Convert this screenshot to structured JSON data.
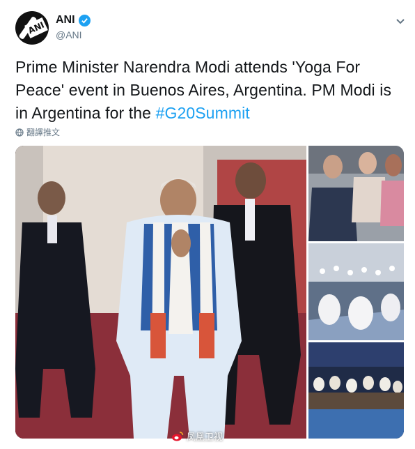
{
  "tweet": {
    "display_name": "ANI",
    "handle": "@ANI",
    "text_before": "Prime Minister Narendra Modi attends 'Yoga For Peace' event in Buenos Aires, Argentina. PM Modi is in Argentina for the ",
    "hashtag": "#G20Summit",
    "translate_label": "翻譯推文",
    "icons": [
      "verified-badge-icon",
      "chevron-down-icon",
      "globe-icon"
    ]
  },
  "watermark": {
    "text": "凤凰卫视"
  },
  "colors": {
    "accent": "#1da1f2",
    "text_primary": "#14171a",
    "text_secondary": "#657786"
  }
}
